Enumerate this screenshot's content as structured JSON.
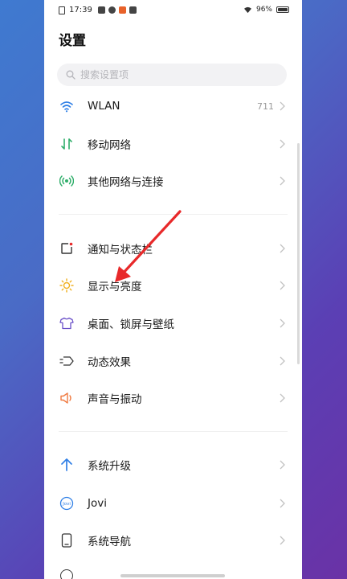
{
  "status": {
    "time": "17:39",
    "battery": "96%"
  },
  "header": {
    "title": "设置"
  },
  "search": {
    "placeholder": "搜索设置项"
  },
  "items": [
    {
      "label": "WLAN",
      "value": "711",
      "icon": "wifi-icon"
    },
    {
      "label": "移动网络",
      "icon": "mobile-network-icon"
    },
    {
      "label": "其他网络与连接",
      "icon": "connections-icon"
    },
    {
      "label": "通知与状态栏",
      "icon": "notification-icon"
    },
    {
      "label": "显示与亮度",
      "icon": "brightness-icon"
    },
    {
      "label": "桌面、锁屏与壁纸",
      "icon": "wallpaper-icon"
    },
    {
      "label": "动态效果",
      "icon": "motion-effects-icon"
    },
    {
      "label": "声音与振动",
      "icon": "sound-icon"
    },
    {
      "label": "系统升级",
      "icon": "system-update-icon"
    },
    {
      "label": "Jovi",
      "icon": "jovi-icon"
    },
    {
      "label": "系统导航",
      "icon": "system-navigation-icon"
    }
  ],
  "colors": {
    "wifi": "#2f7fe6",
    "mobile": "#2fae6a",
    "brightness": "#f0b020",
    "sound": "#f07a40",
    "annotation_arrow": "#e8292a"
  }
}
